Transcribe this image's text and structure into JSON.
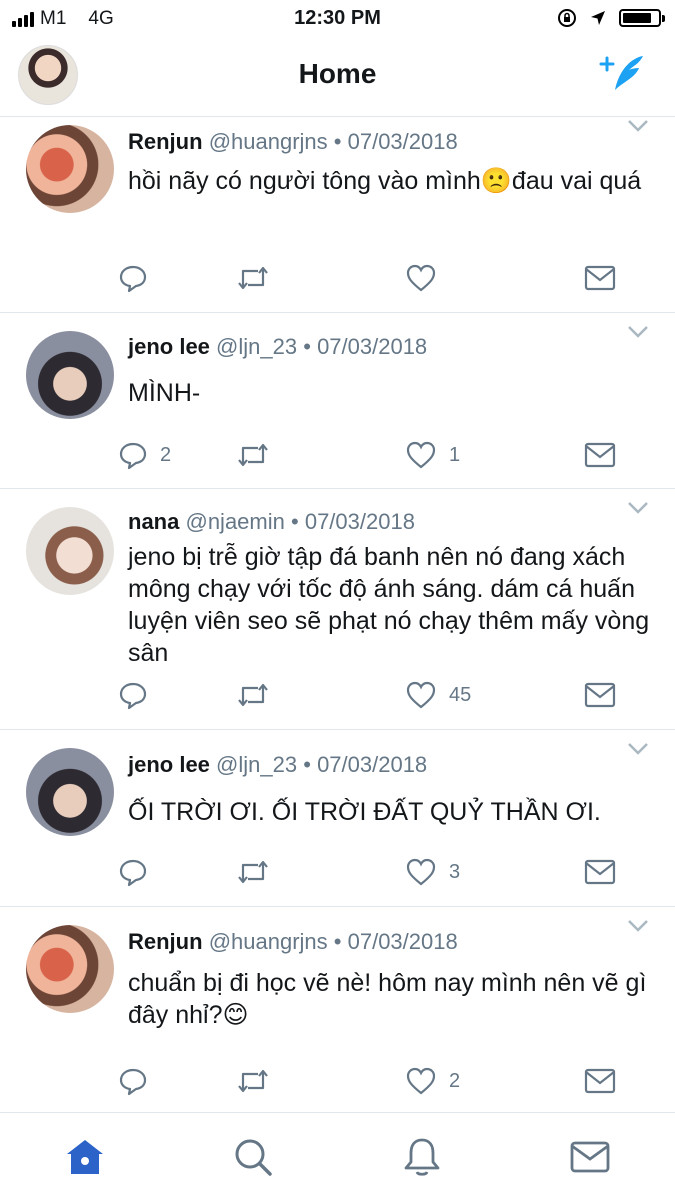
{
  "status_bar": {
    "carrier": "M1",
    "network": "4G",
    "time": "12:30 PM",
    "battery_level": 0.85
  },
  "header": {
    "title": "Home"
  },
  "colors": {
    "accent": "#1da1f2",
    "tab_active": "#2b63c8",
    "text": "#14171a",
    "muted": "#657786",
    "divider": "#e1e8ed"
  },
  "tweets": [
    {
      "name": "Renjun",
      "handle": "@huangrjns",
      "date": "07/03/2018",
      "text": "hồi nãy có người tông vào mình🙁đau vai quá",
      "replies": "",
      "likes": ""
    },
    {
      "name": "jeno lee",
      "handle": "@ljn_23",
      "date": "07/03/2018",
      "text": "MÌNH-",
      "replies": "2",
      "likes": "1"
    },
    {
      "name": "nana",
      "handle": "@njaemin",
      "date": "07/03/2018",
      "text": "jeno bị trễ giờ tập đá banh nên nó đang xách mông chạy với tốc độ ánh sáng. dám cá huấn luyện viên seo sẽ phạt nó chạy thêm mấy vòng sân",
      "replies": "",
      "likes": "45"
    },
    {
      "name": "jeno lee",
      "handle": "@ljn_23",
      "date": "07/03/2018",
      "text": "ỐI TRỜI ƠI. ỐI TRỜI ĐẤT QUỶ THẦN ƠI.",
      "replies": "",
      "likes": "3"
    },
    {
      "name": "Renjun",
      "handle": "@huangrjns",
      "date": "07/03/2018",
      "text": "chuẩn bị đi học vẽ nè! hôm nay mình nên vẽ gì đây nhỉ?😊",
      "replies": "",
      "likes": "2"
    }
  ],
  "tab_bar": {
    "items": [
      "home-icon",
      "search-icon",
      "notifications-icon",
      "messages-icon"
    ],
    "active": "home-icon"
  }
}
